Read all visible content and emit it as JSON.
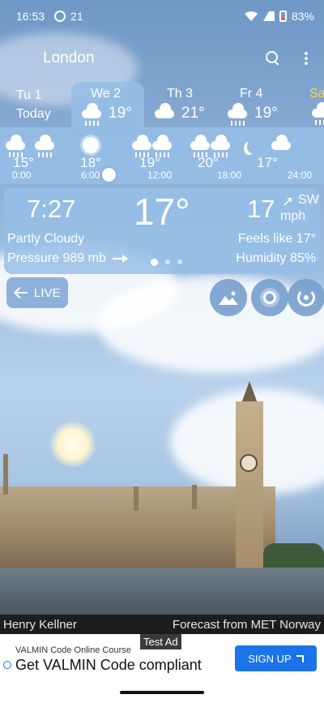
{
  "status_bar": {
    "time": "16:53",
    "temp_indicator": "21",
    "battery": "83%"
  },
  "header": {
    "city": "London"
  },
  "days": [
    {
      "name": "Tu 1",
      "sub": "Today",
      "temp": ""
    },
    {
      "name": "We 2",
      "sub": "",
      "temp": "19°"
    },
    {
      "name": "Th 3",
      "sub": "",
      "temp": "21°"
    },
    {
      "name": "Fr 4",
      "sub": "",
      "temp": "19°"
    },
    {
      "name": "Sa",
      "sub": "",
      "temp": ""
    }
  ],
  "hourly": {
    "temps": [
      "15°",
      "18°",
      "19°",
      "20°",
      "17°"
    ],
    "times": [
      "0:00",
      "6:00",
      "12:00",
      "18:00",
      "24:00"
    ]
  },
  "current": {
    "time": "7:27",
    "temp": "17°",
    "wind_speed": "17",
    "wind_dir": "SW",
    "wind_unit": "mph",
    "condition": "Partly Cloudy",
    "pressure": "Pressure 989 mb",
    "feels_like": "Feels like 17°",
    "humidity": "Humidity 85%"
  },
  "live_label": "LIVE",
  "credits": {
    "photographer": "Henry Kellner",
    "source": "Forecast from MET Norway"
  },
  "ad": {
    "tag": "Test Ad",
    "subtitle": "VALMIN Code Online Course",
    "title": "Get VALMIN Code compliant",
    "cta": "SIGN UP"
  },
  "icons": {
    "status": [
      "gear-icon",
      "wifi-icon",
      "signal-icon",
      "battery-icon"
    ],
    "header": [
      "search-icon",
      "more-vert-icon"
    ],
    "actions": [
      "landscape-icon",
      "sun-weather-icon",
      "radar-icon"
    ]
  }
}
